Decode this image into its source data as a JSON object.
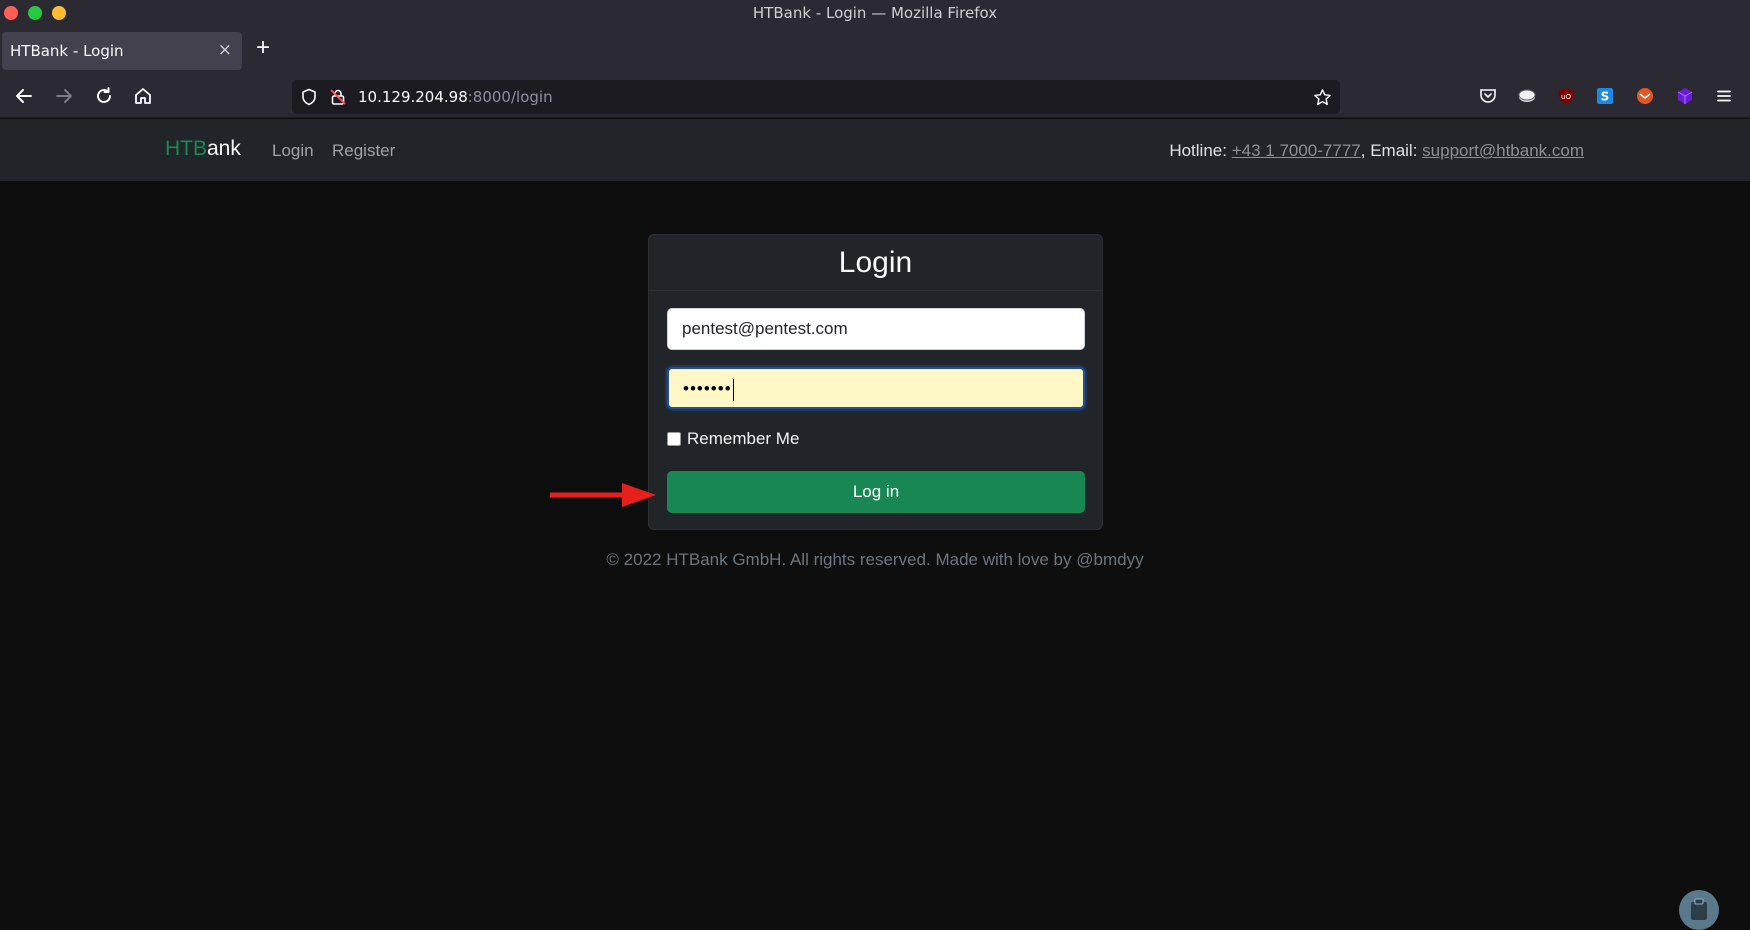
{
  "window": {
    "title": "HTBank - Login — Mozilla Firefox"
  },
  "tabs": [
    {
      "label": "HTBank - Login",
      "close": "×"
    }
  ],
  "new_tab": "+",
  "url": {
    "host": "10.129.204.98",
    "path": ":8000/login"
  },
  "site": {
    "brand_hl": "HTB",
    "brand_rest": "ank",
    "nav": [
      {
        "label": "Login"
      },
      {
        "label": "Register"
      }
    ],
    "contact": {
      "hotline_label": "Hotline: ",
      "phone": "+43 1 7000-7777",
      "email_label": ", Email: ",
      "email": "support@htbank.com"
    }
  },
  "login": {
    "title": "Login",
    "email_value": "pentest@pentest.com",
    "password_mask": "•••••••",
    "remember_label": "Remember Me",
    "remember_checked": false,
    "submit_label": "Log in"
  },
  "footer": "© 2022 HTBank GmbH. All rights reserved. Made with love by @bmdyy",
  "annotation": {
    "arrow_color": "#e8201c"
  },
  "colors": {
    "accent": "#198754",
    "background": "#0e0e0f",
    "navbar": "#212529"
  }
}
